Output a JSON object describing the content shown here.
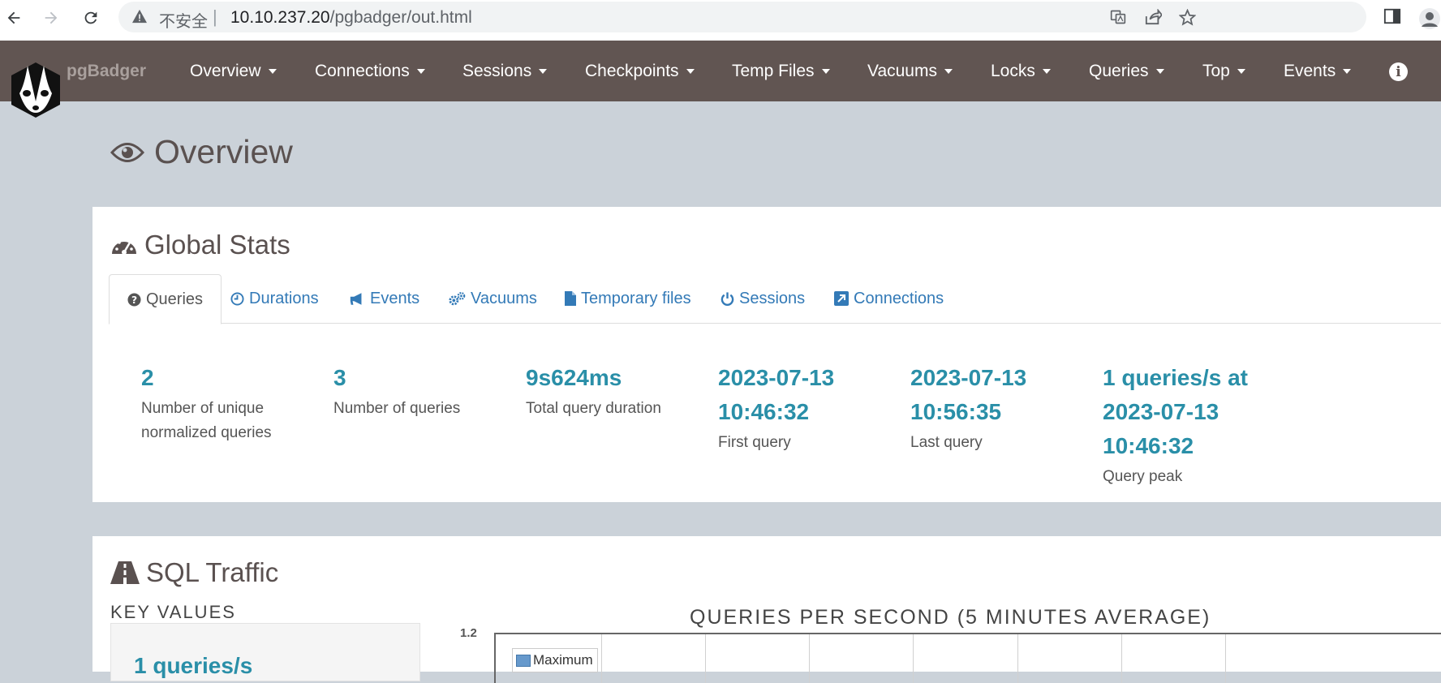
{
  "browser": {
    "insecure_label": "不安全",
    "url_host": "10.10.237.20",
    "url_path": "/pgbadger/out.html"
  },
  "navbar": {
    "brand": "pgBadger",
    "menu": [
      "Overview",
      "Connections",
      "Sessions",
      "Checkpoints",
      "Temp Files",
      "Vacuums",
      "Locks",
      "Queries",
      "Top",
      "Events"
    ]
  },
  "page": {
    "title": "Overview"
  },
  "global_stats": {
    "title": "Global Stats",
    "tabs": [
      {
        "label": "Queries",
        "icon": "question-circle-icon",
        "active": true
      },
      {
        "label": "Durations",
        "icon": "clock-icon"
      },
      {
        "label": "Events",
        "icon": "bullhorn-icon"
      },
      {
        "label": "Vacuums",
        "icon": "cogs-icon"
      },
      {
        "label": "Temporary files",
        "icon": "file-icon"
      },
      {
        "label": "Sessions",
        "icon": "power-icon"
      },
      {
        "label": "Connections",
        "icon": "external-link-icon"
      }
    ],
    "stats": [
      {
        "value_lines": [
          "2"
        ],
        "label": "Number of unique normalized queries"
      },
      {
        "value_lines": [
          "3"
        ],
        "label": "Number of queries"
      },
      {
        "value_lines": [
          "9s624ms"
        ],
        "label": "Total query duration"
      },
      {
        "value_lines": [
          "2023-07-13",
          "10:46:32"
        ],
        "label": "First query"
      },
      {
        "value_lines": [
          "2023-07-13",
          "10:56:35"
        ],
        "label": "Last query"
      },
      {
        "value_lines": [
          "1 queries/s at",
          "2023-07-13",
          "10:46:32"
        ],
        "label": "Query peak"
      }
    ]
  },
  "sql_traffic": {
    "title": "SQL Traffic",
    "key_values_title": "KEY VALUES",
    "key_value": "1 queries/s",
    "chart_title": "QUERIES PER SECOND (5 MINUTES AVERAGE)"
  },
  "chart_data": {
    "type": "line",
    "title": "QUERIES PER SECOND (5 MINUTES AVERAGE)",
    "y_ticks": [
      "1.2"
    ],
    "series": [
      {
        "name": "Maximum",
        "values": []
      }
    ],
    "legend_position": "top-left",
    "grid": true
  },
  "colors": {
    "navbar": "#615552",
    "accent": "#2a8fa8",
    "link": "#337ab7",
    "background": "#cbd2d9"
  }
}
